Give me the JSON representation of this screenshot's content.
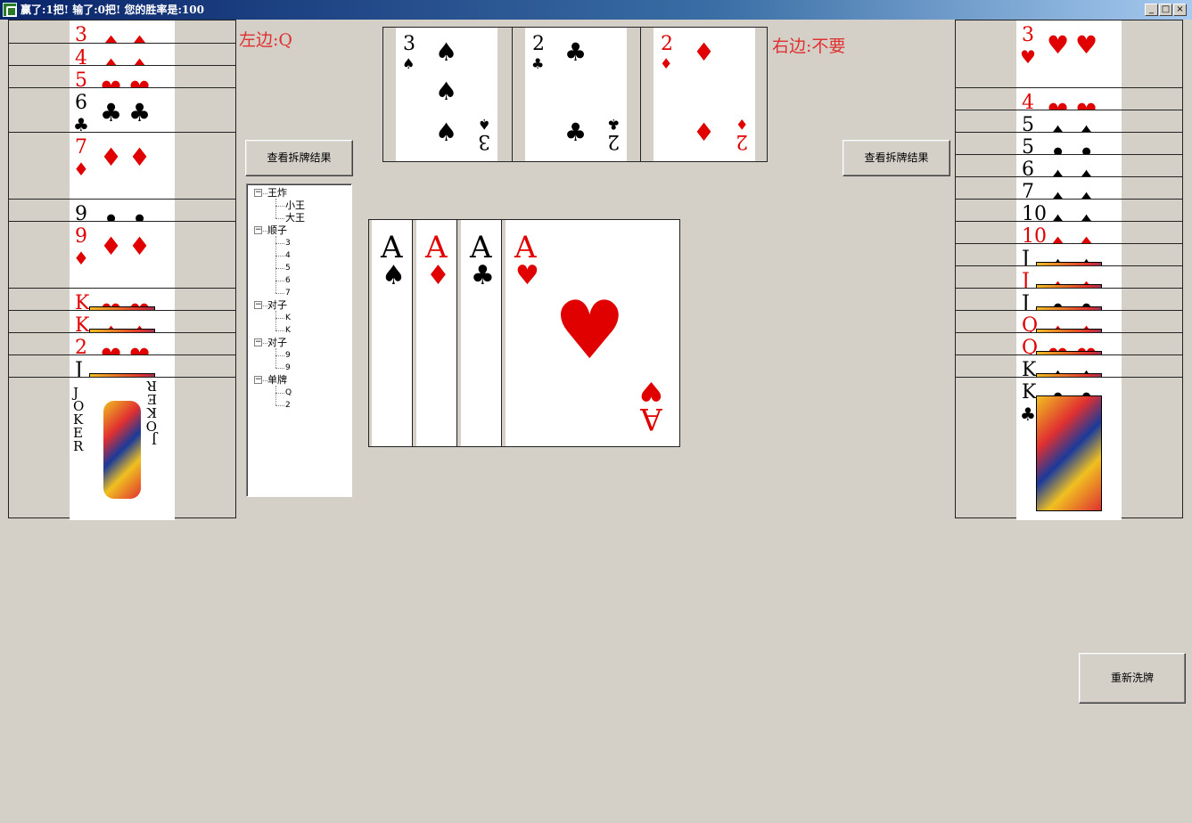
{
  "window": {
    "title": "赢了:1把! 输了:0把! 您的胜率是:100",
    "minimize": "_",
    "maximize": "□",
    "close": "×"
  },
  "left_player": {
    "last_play_label": "左边:Q",
    "view_button": "查看拆牌结果",
    "cards": [
      {
        "rank": "3",
        "suit": "♦",
        "color": "red"
      },
      {
        "rank": "4",
        "suit": "♦",
        "color": "red"
      },
      {
        "rank": "5",
        "suit": "♥",
        "color": "red"
      },
      {
        "rank": "6",
        "suit": "♣",
        "color": "black"
      },
      {
        "rank": "7",
        "suit": "♦",
        "color": "red"
      },
      {
        "rank": "9",
        "suit": "♣",
        "color": "black"
      },
      {
        "rank": "9",
        "suit": "♦",
        "color": "red"
      },
      {
        "rank": "K",
        "suit": "♥",
        "color": "red"
      },
      {
        "rank": "K",
        "suit": "♦",
        "color": "red"
      },
      {
        "rank": "2",
        "suit": "♥",
        "color": "red"
      },
      {
        "rank": "J",
        "suit": "",
        "color": "black"
      },
      {
        "rank": "JOKER",
        "suit": "",
        "color": "black"
      }
    ]
  },
  "right_player": {
    "last_play_label": "右边:不要",
    "view_button": "查看拆牌结果",
    "cards": [
      {
        "rank": "3",
        "suit": "♥",
        "color": "red"
      },
      {
        "rank": "4",
        "suit": "♥",
        "color": "red"
      },
      {
        "rank": "5",
        "suit": "♠",
        "color": "black"
      },
      {
        "rank": "5",
        "suit": "♣",
        "color": "black"
      },
      {
        "rank": "6",
        "suit": "♠",
        "color": "black"
      },
      {
        "rank": "7",
        "suit": "♠",
        "color": "black"
      },
      {
        "rank": "10",
        "suit": "♠",
        "color": "black"
      },
      {
        "rank": "10",
        "suit": "♦",
        "color": "red"
      },
      {
        "rank": "J",
        "suit": "♠",
        "color": "black"
      },
      {
        "rank": "J",
        "suit": "♦",
        "color": "red"
      },
      {
        "rank": "J",
        "suit": "♣",
        "color": "black"
      },
      {
        "rank": "Q",
        "suit": "♦",
        "color": "red"
      },
      {
        "rank": "Q",
        "suit": "♥",
        "color": "red"
      },
      {
        "rank": "K",
        "suit": "♠",
        "color": "black"
      },
      {
        "rank": "K",
        "suit": "♣",
        "color": "black"
      }
    ]
  },
  "bottom_cards": [
    {
      "rank": "3",
      "suit": "♠",
      "color": "black"
    },
    {
      "rank": "2",
      "suit": "♣",
      "color": "black"
    },
    {
      "rank": "2",
      "suit": "♦",
      "color": "red"
    }
  ],
  "played_cards": [
    {
      "rank": "A",
      "suit": "♠",
      "color": "black"
    },
    {
      "rank": "A",
      "suit": "♦",
      "color": "red"
    },
    {
      "rank": "A",
      "suit": "♣",
      "color": "black"
    },
    {
      "rank": "A",
      "suit": "♥",
      "color": "red"
    }
  ],
  "split_tree": [
    {
      "label": "王炸",
      "children": [
        "小王",
        "大王"
      ]
    },
    {
      "label": "顺子",
      "children": [
        "3",
        "4",
        "5",
        "6",
        "7"
      ]
    },
    {
      "label": "对子",
      "children": [
        "K",
        "K"
      ]
    },
    {
      "label": "对子",
      "children": [
        "9",
        "9"
      ]
    },
    {
      "label": "单牌",
      "children": [
        "Q",
        "2"
      ]
    }
  ],
  "reshuffle_button": "重新洗牌",
  "colors": {
    "red": "#e00000",
    "black": "#000000",
    "label_red": "#e03030",
    "background": "#d4d0c8"
  }
}
